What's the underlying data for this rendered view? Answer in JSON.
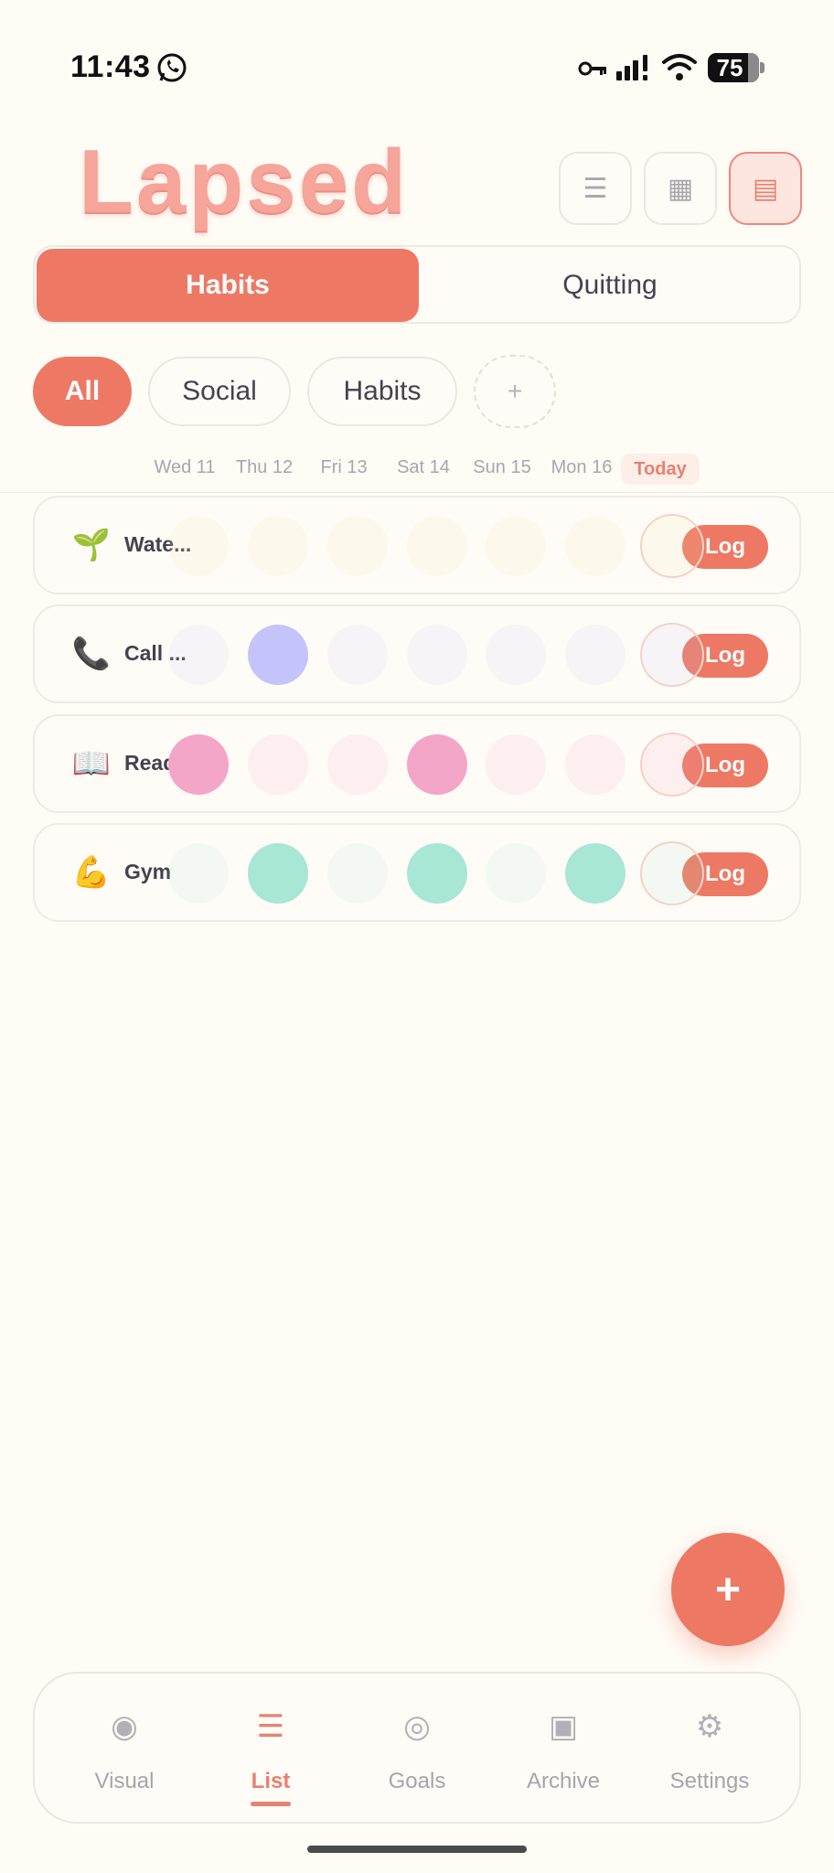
{
  "status_bar": {
    "time": "11:43",
    "battery": "75"
  },
  "app": {
    "title": "Lapsed"
  },
  "view_buttons": [
    {
      "name": "list-view",
      "glyph": "☰",
      "active": false
    },
    {
      "name": "grid-view",
      "glyph": "▦",
      "active": false
    },
    {
      "name": "compact-view",
      "glyph": "▤",
      "active": true
    }
  ],
  "mode_tabs": [
    {
      "label": "Habits",
      "active": true
    },
    {
      "label": "Quitting",
      "active": false
    }
  ],
  "filter_chips": [
    {
      "label": "All",
      "active": true
    },
    {
      "label": "Social",
      "active": false
    },
    {
      "label": "Habits",
      "active": false
    },
    {
      "label": "+",
      "active": false
    }
  ],
  "days": [
    "Wed 11",
    "Thu 12",
    "Fri 13",
    "Sat 14",
    "Sun 15",
    "Mon 16",
    "Today"
  ],
  "habits": [
    {
      "emoji": "🌱",
      "name": "Wate...",
      "color": "#f4e4a8",
      "done": [
        false,
        false,
        false,
        false,
        false,
        false,
        false
      ],
      "log_label": "Log"
    },
    {
      "emoji": "📞",
      "name": "Call ...",
      "color": "#c4c4fb",
      "done": [
        false,
        true,
        false,
        false,
        false,
        false,
        false
      ],
      "log_label": "Log"
    },
    {
      "emoji": "📖",
      "name": "Read...",
      "color": "#f4a6c8",
      "done": [
        true,
        false,
        false,
        true,
        false,
        false,
        false
      ],
      "log_label": "Log"
    },
    {
      "emoji": "💪",
      "name": "Gym",
      "color": "#a8e6d5",
      "done": [
        false,
        true,
        false,
        true,
        false,
        true,
        false
      ],
      "log_label": "Log"
    }
  ],
  "fab": {
    "label": "+"
  },
  "bottom_nav": [
    {
      "icon": "◉",
      "label": "Visual",
      "active": false
    },
    {
      "icon": "☰",
      "label": "List",
      "active": true
    },
    {
      "icon": "◎",
      "label": "Goals",
      "active": false
    },
    {
      "icon": "▣",
      "label": "Archive",
      "active": false
    },
    {
      "icon": "⚙",
      "label": "Settings",
      "active": false
    }
  ],
  "colors": {
    "accent": "#ed7964",
    "background": "#fffcf6",
    "today_highlight": "#fdeee8"
  }
}
